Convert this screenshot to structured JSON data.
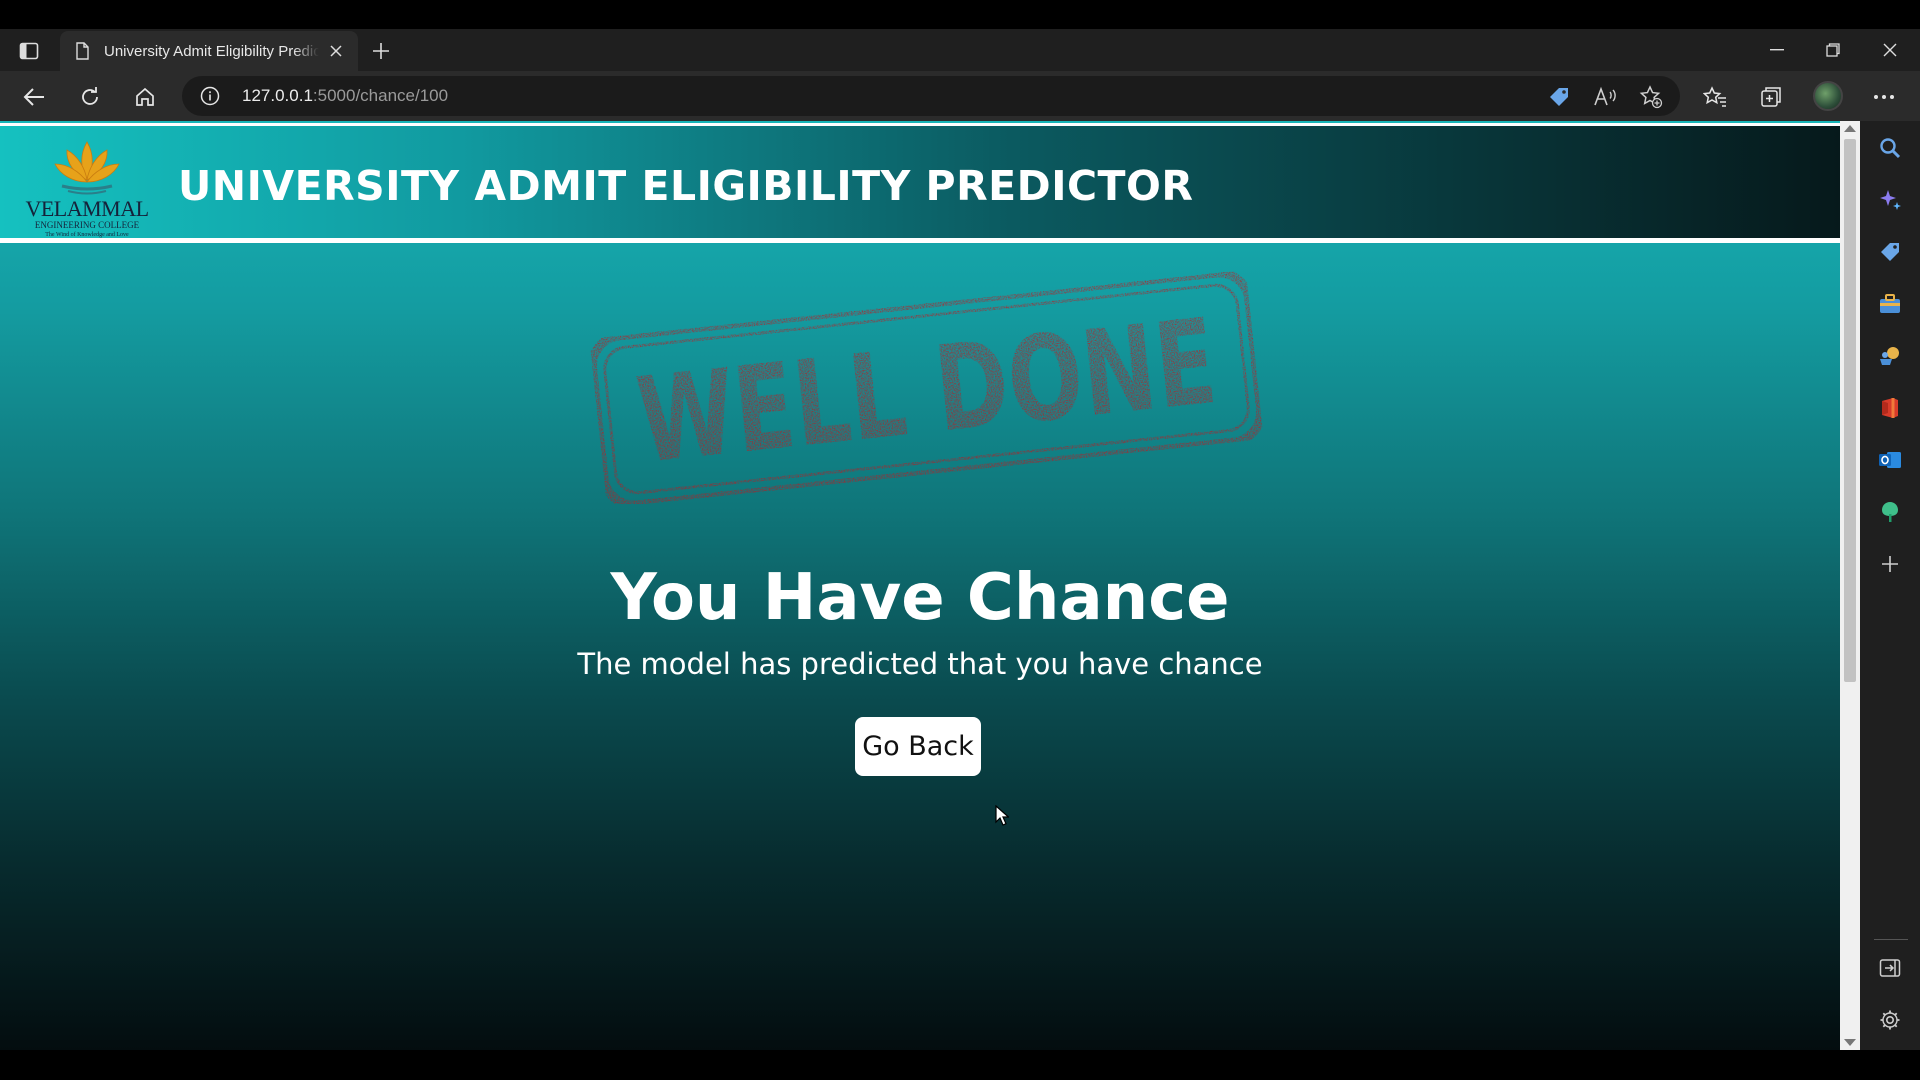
{
  "browser": {
    "tab_title": "University Admit Eligibility Predictor",
    "url_host": "127.0.0.1",
    "url_path": ":5000/chance/100",
    "icons": {
      "tab_actions": "tab-actions-icon",
      "new_tab": "plus-icon",
      "back": "back-arrow-icon",
      "refresh": "refresh-icon",
      "home": "home-icon",
      "site_info": "info-icon",
      "shopping": "shopping-tag-icon",
      "read_aloud": "read-aloud-icon",
      "add_favorite": "star-plus-icon",
      "favorites": "favorites-icon",
      "collections": "collections-icon",
      "more": "ellipsis-icon"
    }
  },
  "page": {
    "logo_name": "VELAMMAL",
    "logo_sub": "ENGINEERING COLLEGE",
    "logo_tagline": "The Wind of Knowledge and Love",
    "site_title": "UNIVERSITY ADMIT ELIGIBILITY PREDICTOR",
    "stamp_text": "WELL DONE",
    "result_heading": "You Have Chance",
    "result_subtext": "The model has predicted that you have chance",
    "go_back_label": "Go Back"
  },
  "colors": {
    "header_left": "#15c1c0",
    "header_right": "#06191b",
    "stamp_red": "#c4161c",
    "page_top": "#17b5b8",
    "page_bottom": "#040d0f"
  }
}
